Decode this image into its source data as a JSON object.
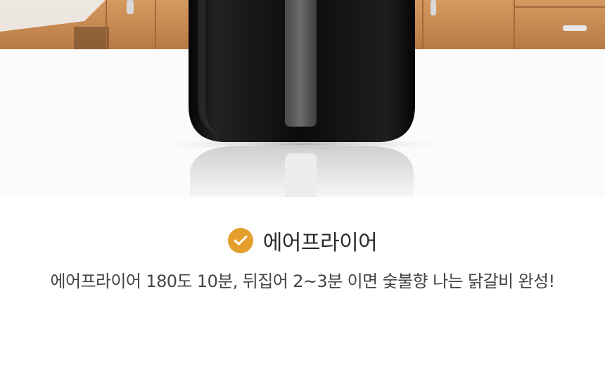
{
  "colors": {
    "accent": "#e39e2c",
    "heading": "#2b2b2b",
    "body_text": "#444444",
    "fryer_body": "#0d0d0d",
    "handle": "#5a5a5a",
    "counter_wood": "#c88a52"
  },
  "product_photo": {
    "subject": "black air fryer on kitchen counter with reflection"
  },
  "section": {
    "check_icon": "checkmark-circle-icon",
    "title": "에어프라이어",
    "description": "에어프라이어 180도 10분, 뒤집어 2~3분 이면 숯불향 나는 닭갈비 완성!"
  }
}
